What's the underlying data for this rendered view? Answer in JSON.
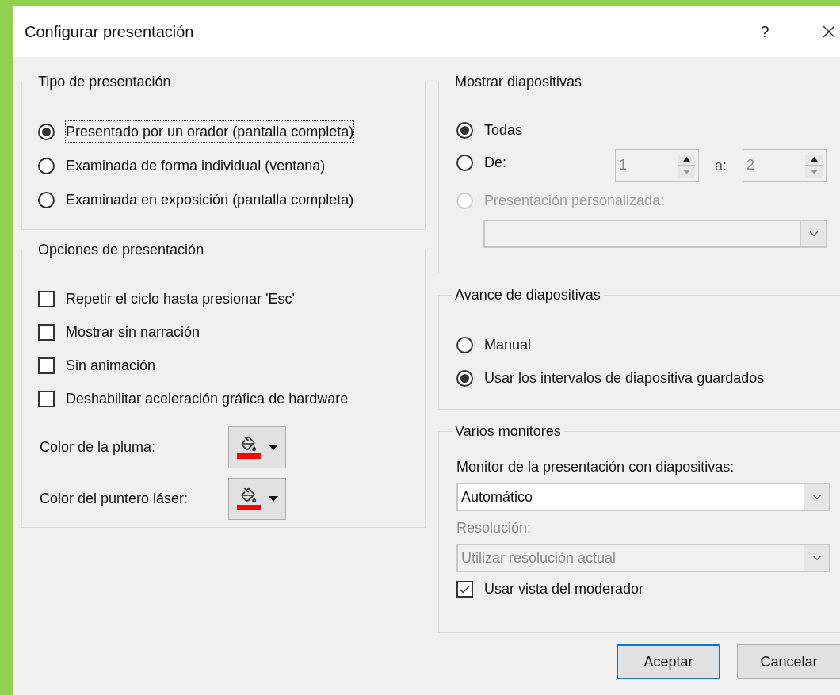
{
  "dialog": {
    "title": "Configurar presentación",
    "help_button": "?"
  },
  "presentation_type": {
    "legend": "Tipo de presentación",
    "options": [
      {
        "label": "Presentado por un orador (pantalla completa)",
        "selected": true
      },
      {
        "label": "Examinada de forma individual (ventana)",
        "selected": false
      },
      {
        "label": "Examinada en exposición (pantalla completa)",
        "selected": false
      }
    ]
  },
  "show_options": {
    "legend": "Opciones de presentación",
    "checkboxes": [
      {
        "label": "Repetir el ciclo hasta presionar 'Esc'",
        "checked": false
      },
      {
        "label": "Mostrar sin narración",
        "checked": false
      },
      {
        "label": "Sin animación",
        "checked": false
      },
      {
        "label": "Deshabilitar aceleración gráfica de hardware",
        "checked": false
      }
    ],
    "color_pickers": [
      {
        "label": "Color de la pluma:",
        "color": "#ff0000"
      },
      {
        "label": "Color del puntero láser:",
        "color": "#ff0000"
      }
    ]
  },
  "show_slides": {
    "legend": "Mostrar diapositivas",
    "options": [
      {
        "kind": "all",
        "label": "Todas",
        "selected": true,
        "disabled": false
      },
      {
        "kind": "range",
        "label": "De:",
        "selected": false,
        "disabled": false,
        "from_value": "1",
        "to_label": "a:",
        "to_value": "2"
      },
      {
        "kind": "custom",
        "label": "Presentación personalizada:",
        "selected": false,
        "disabled": true
      }
    ]
  },
  "advance": {
    "legend": "Avance de diapositivas",
    "options": [
      {
        "label": "Manual",
        "selected": false
      },
      {
        "label": "Usar los intervalos de diapositiva guardados",
        "selected": true
      }
    ]
  },
  "monitors": {
    "legend": "Varios monitores",
    "monitor_label": "Monitor de la presentación con diapositivas:",
    "monitor_value": "Automático",
    "resolution_label": "Resolución:",
    "resolution_value": "Utilizar resolución actual",
    "resolution_disabled": true,
    "presenter_view": {
      "label": "Usar vista del moderador",
      "checked": true
    }
  },
  "buttons": [
    {
      "label": "Aceptar",
      "default": true
    },
    {
      "label": "Cancelar",
      "default": false
    }
  ]
}
